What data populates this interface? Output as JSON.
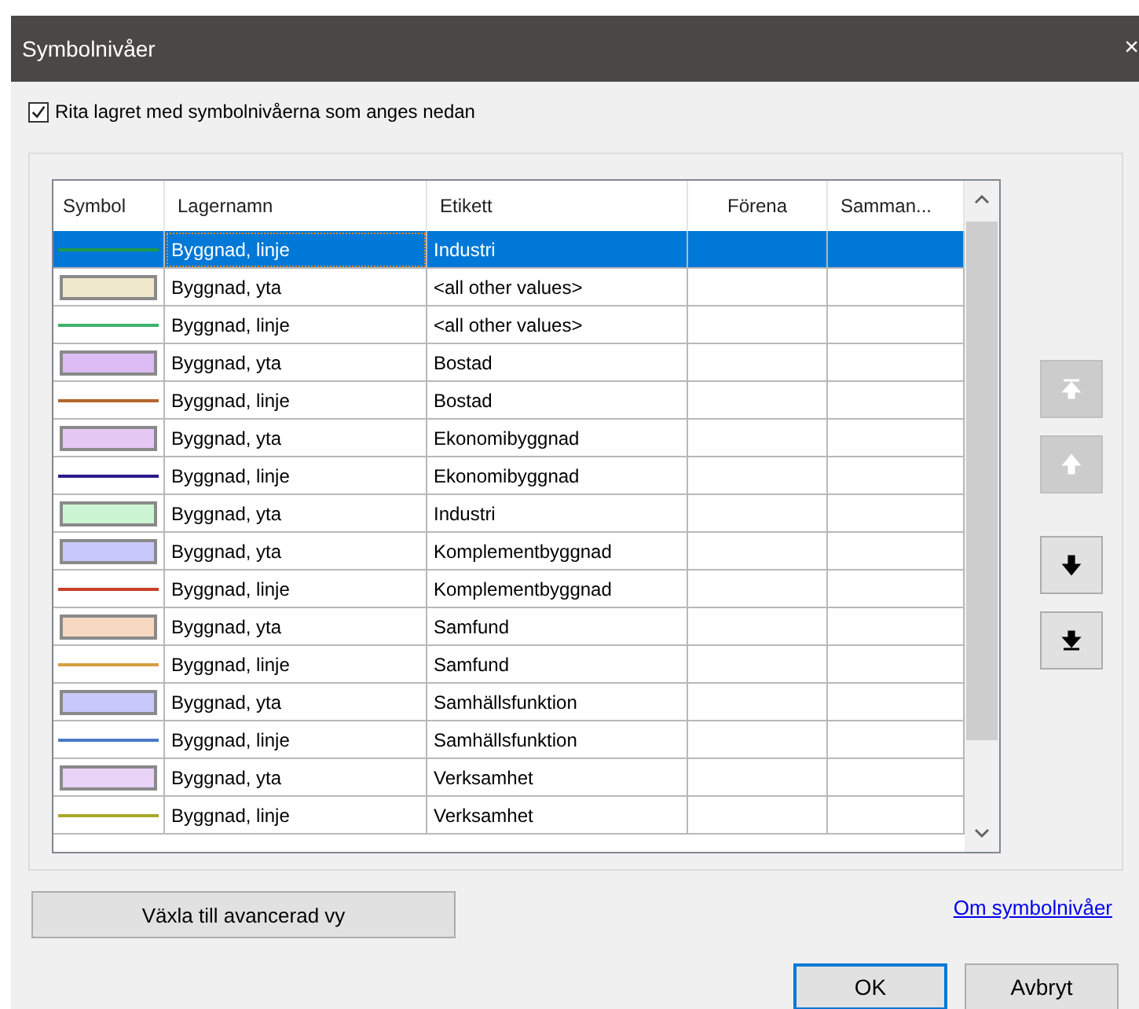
{
  "window": {
    "title": "Symbolnivåer",
    "close": "×"
  },
  "draw_levels": {
    "label": "Rita lagret med symbolnivåerna som anges nedan",
    "checked": true
  },
  "table": {
    "columns": [
      "Symbol",
      "Lagernamn",
      "Etikett",
      "Förena",
      "Samman..."
    ],
    "rows": [
      {
        "symbol": {
          "kind": "line",
          "color": "#1f9a47"
        },
        "layer": "Byggnad, linje",
        "label": "Industri",
        "selected": true
      },
      {
        "symbol": {
          "kind": "fill",
          "color": "#f0e8cc"
        },
        "layer": "Byggnad, yta",
        "label": "<all other values>",
        "selected": false
      },
      {
        "symbol": {
          "kind": "line",
          "color": "#3cb36e"
        },
        "layer": "Byggnad, linje",
        "label": "<all other values>",
        "selected": false
      },
      {
        "symbol": {
          "kind": "fill",
          "color": "#dcbcf2"
        },
        "layer": "Byggnad, yta",
        "label": "Bostad",
        "selected": false
      },
      {
        "symbol": {
          "kind": "line",
          "color": "#b5652a"
        },
        "layer": "Byggnad, linje",
        "label": "Bostad",
        "selected": false
      },
      {
        "symbol": {
          "kind": "fill",
          "color": "#e6c8f5"
        },
        "layer": "Byggnad, yta",
        "label": "Ekonomibyggnad",
        "selected": false
      },
      {
        "symbol": {
          "kind": "line",
          "color": "#2a1a8c"
        },
        "layer": "Byggnad, linje",
        "label": "Ekonomibyggnad",
        "selected": false
      },
      {
        "symbol": {
          "kind": "fill",
          "color": "#ccf5d4"
        },
        "layer": "Byggnad, yta",
        "label": "Industri",
        "selected": false
      },
      {
        "symbol": {
          "kind": "fill",
          "color": "#c8c8fa"
        },
        "layer": "Byggnad, yta",
        "label": "Komplementbyggnad",
        "selected": false
      },
      {
        "symbol": {
          "kind": "line",
          "color": "#c8402a"
        },
        "layer": "Byggnad, linje",
        "label": "Komplementbyggnad",
        "selected": false
      },
      {
        "symbol": {
          "kind": "fill",
          "color": "#f7d9c2"
        },
        "layer": "Byggnad, yta",
        "label": "Samfund",
        "selected": false
      },
      {
        "symbol": {
          "kind": "line",
          "color": "#d4a040"
        },
        "layer": "Byggnad, linje",
        "label": "Samfund",
        "selected": false
      },
      {
        "symbol": {
          "kind": "fill",
          "color": "#c8c8fa"
        },
        "layer": "Byggnad, yta",
        "label": "Samhällsfunktion",
        "selected": false
      },
      {
        "symbol": {
          "kind": "line",
          "color": "#4a7ac8"
        },
        "layer": "Byggnad, linje",
        "label": "Samhällsfunktion",
        "selected": false
      },
      {
        "symbol": {
          "kind": "fill",
          "color": "#e8d2f5"
        },
        "layer": "Byggnad, yta",
        "label": "Verksamhet",
        "selected": false
      },
      {
        "symbol": {
          "kind": "line",
          "color": "#a8a828"
        },
        "layer": "Byggnad, linje",
        "label": "Verksamhet",
        "selected": false
      }
    ]
  },
  "move_buttons": [
    {
      "kind": "top",
      "disabled": true
    },
    {
      "kind": "up",
      "disabled": true
    },
    {
      "kind": "down",
      "disabled": false
    },
    {
      "kind": "bottom",
      "disabled": false
    }
  ],
  "advanced_button": "Växla till avancerad vy",
  "help_link": "Om symbolnivåer",
  "buttons": [
    {
      "label": "OK",
      "default": true
    },
    {
      "label": "Avbryt",
      "default": false
    }
  ]
}
